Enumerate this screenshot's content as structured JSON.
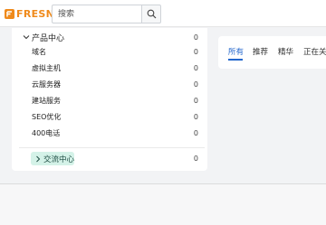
{
  "brand": {
    "name": "FRESNS",
    "color": "#ef8a1b"
  },
  "search": {
    "placeholder": "搜索",
    "icon": "search-icon"
  },
  "sidebar": {
    "groups": [
      {
        "label": "产品中心",
        "count": "0",
        "expanded": true,
        "icon": "chevron-down-icon",
        "items": [
          {
            "label": "域名",
            "count": "0"
          },
          {
            "label": "虚拟主机",
            "count": "0"
          },
          {
            "label": "云服务器",
            "count": "0"
          },
          {
            "label": "建站服务",
            "count": "0"
          },
          {
            "label": "SEO优化",
            "count": "0"
          },
          {
            "label": "400电话",
            "count": "0"
          }
        ]
      },
      {
        "label": "交流中心",
        "count": "0",
        "expanded": false,
        "icon": "chevron-right-icon",
        "highlight_color": "#d4f2e8"
      }
    ]
  },
  "tabs": {
    "items": [
      "所有",
      "推荐",
      "精华",
      "正在关注"
    ],
    "active_index": 0,
    "active_color": "#2266cc"
  }
}
